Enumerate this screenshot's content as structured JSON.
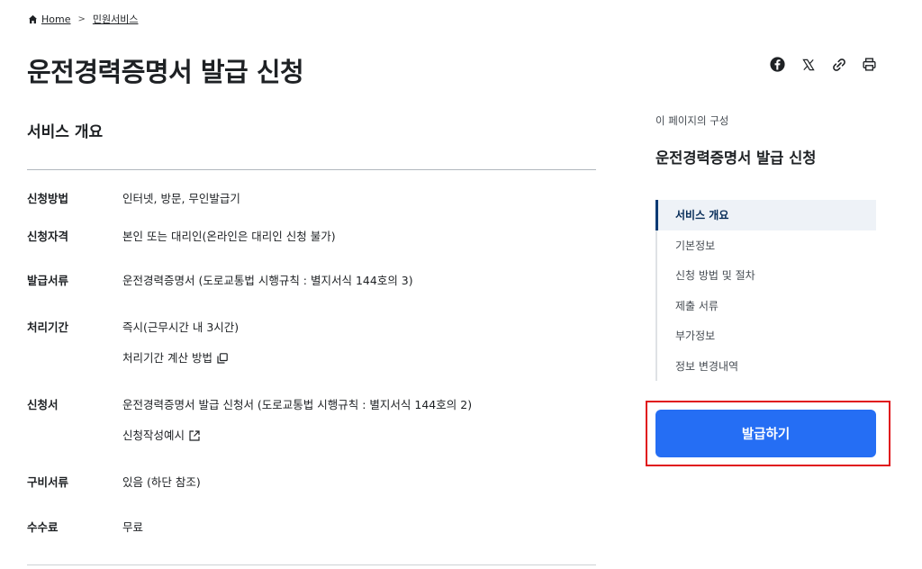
{
  "breadcrumb": {
    "home_icon": "home-icon",
    "home_label": "Home",
    "separator": ">",
    "current_label": "민원서비스"
  },
  "page_title": "운전경력증명서 발급 신청",
  "share_tools": [
    "facebook-icon",
    "x-icon",
    "link-clip-icon",
    "print-icon"
  ],
  "section_title": "서비스 개요",
  "info": [
    {
      "term": "신청방법",
      "lines": [
        "인터넷, 방문, 무인발급기"
      ]
    },
    {
      "term": "신청자격",
      "lines": [
        "본인 또는 대리인(온라인은 대리인 신청 불가)"
      ]
    },
    {
      "term": "발급서류",
      "lines": [
        "운전경력증명서 (도로교통법 시행규칙 : 별지서식 144호의 3)"
      ]
    },
    {
      "term": "처리기간",
      "lines": [
        "즉시(근무시간 내 3시간)",
        "처리기간 계산 방법"
      ],
      "link_icon": "copy-window-icon"
    },
    {
      "term": "신청서",
      "lines": [
        "운전경력증명서 발급 신청서 (도로교통법 시행규칙 : 별지서식 144호의 2)",
        "신청작성예시"
      ],
      "link_icon": "external-link-icon"
    },
    {
      "term": "구비서류",
      "lines": [
        "있음 (하단 참조)"
      ]
    },
    {
      "term": "수수료",
      "lines": [
        "무료"
      ]
    }
  ],
  "toc": {
    "caption": "이 페이지의 구성",
    "title": "운전경력증명서 발급 신청",
    "items": [
      "서비스 개요",
      "기본정보",
      "신청 방법 및 절차",
      "제출 서류",
      "부가정보",
      "정보 변경내역"
    ],
    "active_index": 0
  },
  "issue_button_label": "발급하기",
  "colors": {
    "primary": "#256ef4",
    "highlight_outline": "#e0141a",
    "toc_active_bg": "#eef2f7",
    "toc_active_bar": "#063a74"
  }
}
